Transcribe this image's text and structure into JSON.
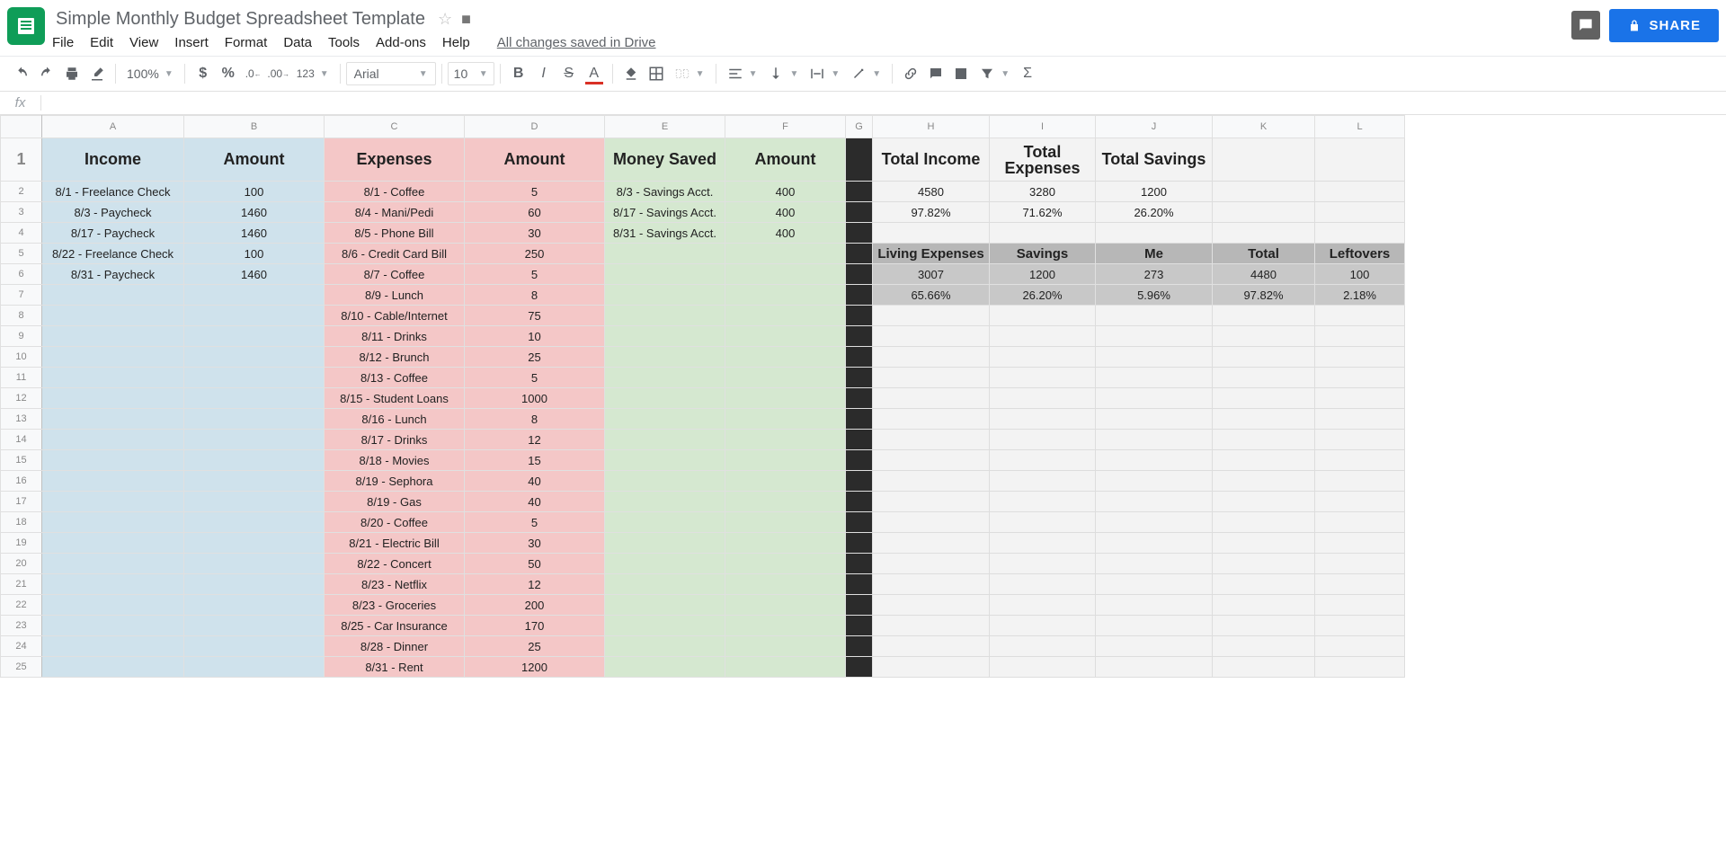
{
  "doc": {
    "title": "Simple Monthly Budget Spreadsheet Template",
    "saved": "All changes saved in Drive"
  },
  "menu": {
    "file": "File",
    "edit": "Edit",
    "view": "View",
    "insert": "Insert",
    "format": "Format",
    "data": "Data",
    "tools": "Tools",
    "addons": "Add-ons",
    "help": "Help"
  },
  "share": "SHARE",
  "toolbar": {
    "zoom": "100%",
    "fmt123": "123",
    "font": "Arial",
    "size": "10"
  },
  "cols": [
    "A",
    "B",
    "C",
    "D",
    "E",
    "F",
    "G",
    "H",
    "I",
    "J",
    "K",
    "L"
  ],
  "headers": {
    "income": "Income",
    "amount1": "Amount",
    "expenses": "Expenses",
    "amount2": "Amount",
    "saved": "Money Saved",
    "amount3": "Amount",
    "tIncome": "Total Income",
    "tExpenses": "Total Expenses",
    "tSavings": "Total Savings"
  },
  "income": [
    {
      "d": "8/1 - Freelance Check",
      "a": "100"
    },
    {
      "d": "8/3 - Paycheck",
      "a": "1460"
    },
    {
      "d": "8/17 - Paycheck",
      "a": "1460"
    },
    {
      "d": "8/22 - Freelance Check",
      "a": "100"
    },
    {
      "d": "8/31 - Paycheck",
      "a": "1460"
    }
  ],
  "expenses": [
    {
      "d": "8/1 - Coffee",
      "a": "5"
    },
    {
      "d": "8/4 - Mani/Pedi",
      "a": "60"
    },
    {
      "d": "8/5 - Phone Bill",
      "a": "30"
    },
    {
      "d": "8/6 - Credit Card Bill",
      "a": "250"
    },
    {
      "d": "8/7 - Coffee",
      "a": "5"
    },
    {
      "d": "8/9 - Lunch",
      "a": "8"
    },
    {
      "d": "8/10 - Cable/Internet",
      "a": "75"
    },
    {
      "d": "8/11 - Drinks",
      "a": "10"
    },
    {
      "d": "8/12 - Brunch",
      "a": "25"
    },
    {
      "d": "8/13 - Coffee",
      "a": "5"
    },
    {
      "d": "8/15 - Student Loans",
      "a": "1000"
    },
    {
      "d": "8/16 - Lunch",
      "a": "8"
    },
    {
      "d": "8/17 - Drinks",
      "a": "12"
    },
    {
      "d": "8/18 - Movies",
      "a": "15"
    },
    {
      "d": "8/19 - Sephora",
      "a": "40"
    },
    {
      "d": "8/19 - Gas",
      "a": "40"
    },
    {
      "d": "8/20 - Coffee",
      "a": "5"
    },
    {
      "d": "8/21 - Electric Bill",
      "a": "30"
    },
    {
      "d": "8/22 - Concert",
      "a": "50"
    },
    {
      "d": "8/23 - Netflix",
      "a": "12"
    },
    {
      "d": "8/23 - Groceries",
      "a": "200"
    },
    {
      "d": "8/25 - Car Insurance",
      "a": "170"
    },
    {
      "d": "8/28 - Dinner",
      "a": "25"
    },
    {
      "d": "8/31 - Rent",
      "a": "1200"
    }
  ],
  "savings": [
    {
      "d": "8/3 - Savings Acct.",
      "a": "400"
    },
    {
      "d": "8/17 - Savings Acct.",
      "a": "400"
    },
    {
      "d": "8/31 - Savings Acct.",
      "a": "400"
    }
  ],
  "totals": {
    "income": "4580",
    "expenses": "3280",
    "savings": "1200",
    "incomeP": "97.82%",
    "expensesP": "71.62%",
    "savingsP": "26.20%"
  },
  "breakdown": {
    "hdr": {
      "living": "Living Expenses",
      "savings": "Savings",
      "me": "Me",
      "total": "Total",
      "left": "Leftovers"
    },
    "amt": {
      "living": "3007",
      "savings": "1200",
      "me": "273",
      "total": "4480",
      "left": "100"
    },
    "pct": {
      "living": "65.66%",
      "savings": "26.20%",
      "me": "5.96%",
      "total": "97.82%",
      "left": "2.18%"
    }
  },
  "chart_data": {
    "type": "table",
    "title": "Simple Monthly Budget",
    "series": [
      {
        "name": "Total Income",
        "values": [
          4580
        ]
      },
      {
        "name": "Total Expenses",
        "values": [
          3280
        ]
      },
      {
        "name": "Total Savings",
        "values": [
          1200
        ]
      }
    ],
    "breakdown": {
      "Living Expenses": 3007,
      "Savings": 1200,
      "Me": 273,
      "Total": 4480,
      "Leftovers": 100
    },
    "breakdown_pct": {
      "Living Expenses": 65.66,
      "Savings": 26.2,
      "Me": 5.96,
      "Total": 97.82,
      "Leftovers": 2.18
    }
  }
}
